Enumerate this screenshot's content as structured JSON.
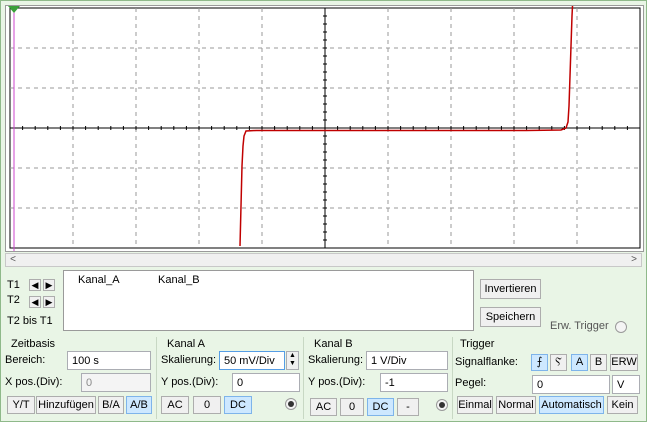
{
  "cursor": {
    "t1_label": "T1",
    "t2_label": "T2",
    "t2_t1_label": "T2 bis T1"
  },
  "table": {
    "col_a": "Kanal_A",
    "col_b": "Kanal_B"
  },
  "buttons": {
    "invert": "Invertieren",
    "save": "Speichern",
    "ext_trigger": "Erw. Trigger"
  },
  "timebase": {
    "title": "Zeitbasis",
    "range_label": "Bereich:",
    "range_value": "100  s",
    "xpos_label": "X pos.(Div):",
    "xpos_value": "0",
    "yt": "Y/T",
    "add": "Hinzufügen",
    "ba": "B/A",
    "ab": "A/B"
  },
  "channel_a": {
    "title": "Kanal A",
    "scale_label": "Skalierung:",
    "scale_value": "50 mV/Div",
    "ypos_label": "Y pos.(Div):",
    "ypos_value": "0",
    "ac": "AC",
    "zero": "0",
    "dc": "DC"
  },
  "channel_b": {
    "title": "Kanal B",
    "scale_label": "Skalierung:",
    "scale_value": "1  V/Div",
    "ypos_label": "Y pos.(Div):",
    "ypos_value": "-1",
    "ac": "AC",
    "zero": "0",
    "dc": "DC",
    "minus": "-"
  },
  "trigger": {
    "title": "Trigger",
    "edge_label": "Signalflanke:",
    "rise": "⨍",
    "fall": "Ⲋ",
    "a": "A",
    "b": "B",
    "ext": "ERW",
    "level_label": "Pegel:",
    "level_value": "0",
    "level_unit": "V",
    "single": "Einmal",
    "normal": "Normal",
    "auto": "Automatisch",
    "none": "Kein"
  },
  "colors": {
    "trace": "#c00000",
    "cursor": "#cc44cc",
    "accent": "#cde8ff"
  }
}
